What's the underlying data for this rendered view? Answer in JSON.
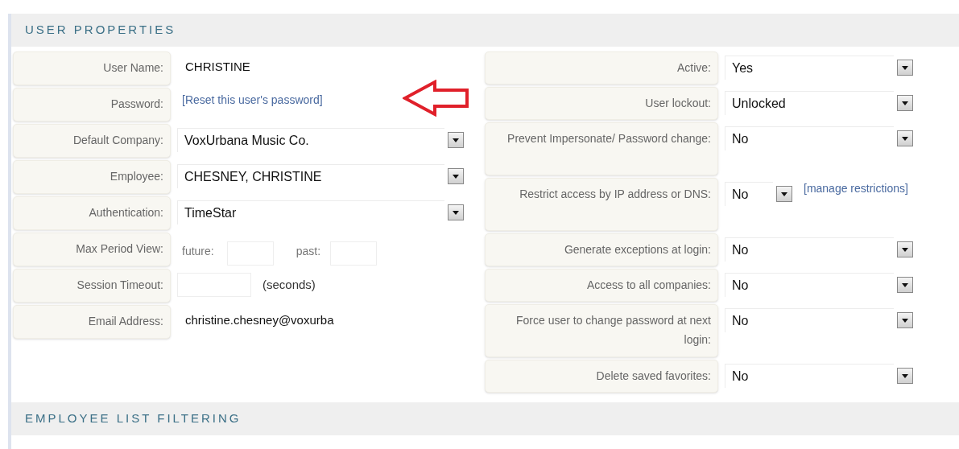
{
  "sections": [
    {
      "title": "USER PROPERTIES",
      "left": [
        {
          "kind": "text",
          "label": "User Name:",
          "value": "CHRISTINE"
        },
        {
          "kind": "link",
          "label": "Password:",
          "link": "[Reset this user's password]"
        },
        {
          "kind": "select",
          "label": "Default Company:",
          "value": "VoxUrbana Music Co."
        },
        {
          "kind": "select",
          "label": "Employee:",
          "value": "CHESNEY, CHRISTINE"
        },
        {
          "kind": "select",
          "label": "Authentication:",
          "value": "TimeStar"
        },
        {
          "kind": "pair",
          "label": "Max Period View:",
          "first": "future:",
          "second": "past:"
        },
        {
          "kind": "unit",
          "label": "Session Timeout:",
          "unit": "(seconds)"
        },
        {
          "kind": "text",
          "label": "Email Address:",
          "value": "christine.chesney@voxurba"
        }
      ],
      "right": [
        {
          "kind": "select",
          "label": "Active:",
          "value": "Yes"
        },
        {
          "kind": "select",
          "label": "User lockout:",
          "value": "Unlocked"
        },
        {
          "kind": "select",
          "label": "Prevent Impersonate/ Password change:",
          "value": "No"
        },
        {
          "kind": "select_link",
          "label": "Restrict access by IP address or DNS:",
          "value": "No",
          "link": "[manage restrictions]"
        },
        {
          "kind": "select",
          "label": "Generate exceptions at login:",
          "value": "No"
        },
        {
          "kind": "select",
          "label": "Access to all companies:",
          "value": "No"
        },
        {
          "kind": "select",
          "label": "Force user to change password at next login:",
          "value": "No"
        },
        {
          "kind": "select",
          "label": "Delete saved favorites:",
          "value": "No"
        }
      ]
    },
    {
      "title": "EMPLOYEE LIST FILTERING"
    }
  ]
}
